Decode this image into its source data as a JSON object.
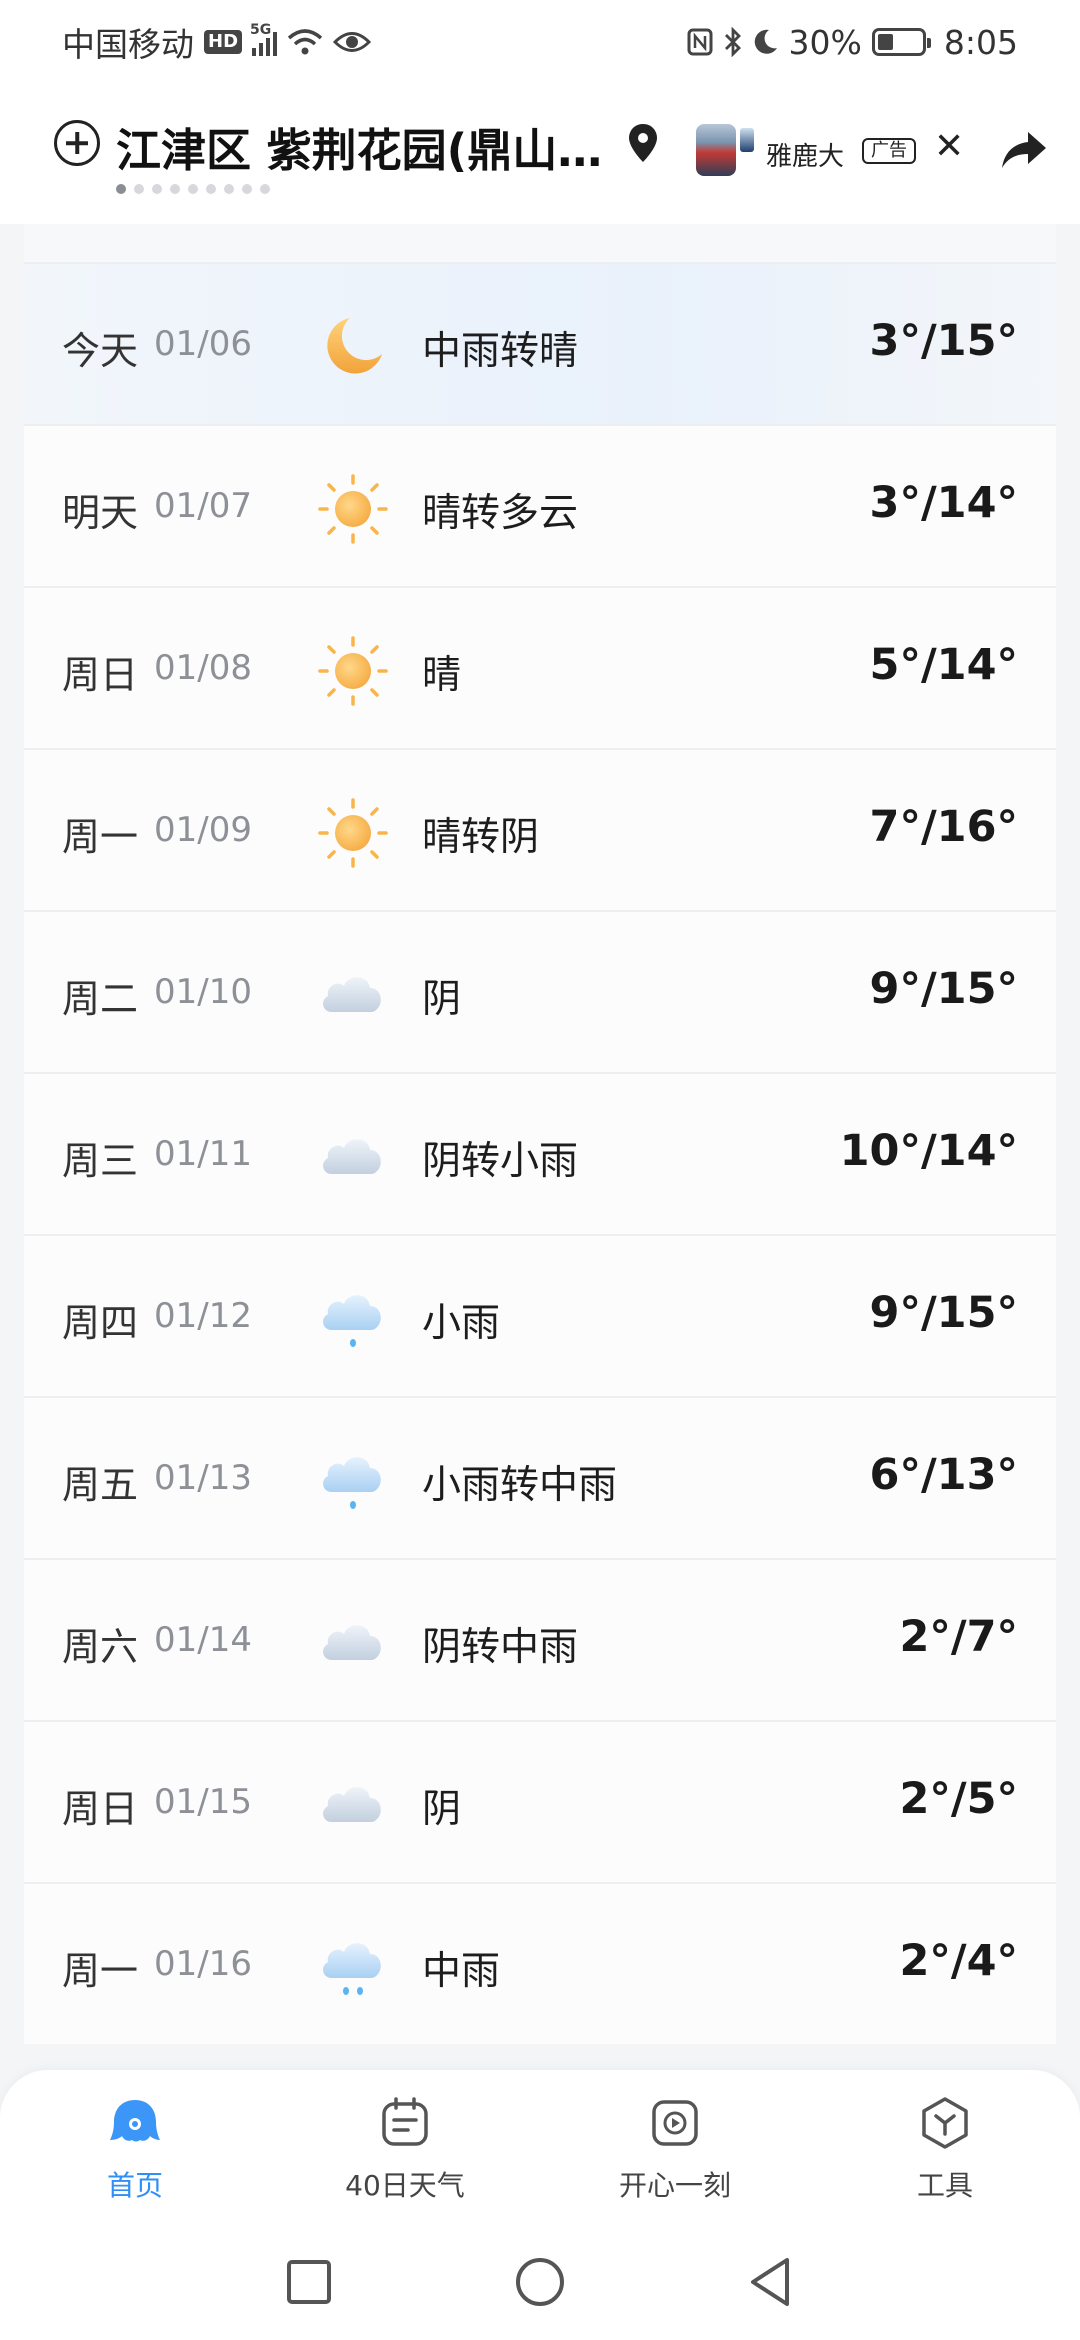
{
  "status_bar": {
    "carrier": "中国移动",
    "hd": "HD",
    "network": "5G",
    "battery": "30%",
    "time": "8:05"
  },
  "header": {
    "location": "江津区 紫荆花园(鼎山…",
    "ad_name": "雅鹿大",
    "ad_badge": "广告",
    "ad_close": "✕"
  },
  "forecast": [
    {
      "day": "今天",
      "date": "01/06",
      "icon": "moon-icon",
      "desc": "中雨转晴",
      "temp": "3°/15°"
    },
    {
      "day": "明天",
      "date": "01/07",
      "icon": "sun-icon",
      "desc": "晴转多云",
      "temp": "3°/14°"
    },
    {
      "day": "周日",
      "date": "01/08",
      "icon": "sun-icon",
      "desc": "晴",
      "temp": "5°/14°"
    },
    {
      "day": "周一",
      "date": "01/09",
      "icon": "sun-icon",
      "desc": "晴转阴",
      "temp": "7°/16°"
    },
    {
      "day": "周二",
      "date": "01/10",
      "icon": "cloud-icon",
      "desc": "阴",
      "temp": "9°/15°"
    },
    {
      "day": "周三",
      "date": "01/11",
      "icon": "cloud-icon",
      "desc": "阴转小雨",
      "temp": "10°/14°"
    },
    {
      "day": "周四",
      "date": "01/12",
      "icon": "light-rain-icon",
      "desc": "小雨",
      "temp": "9°/15°"
    },
    {
      "day": "周五",
      "date": "01/13",
      "icon": "light-rain-icon",
      "desc": "小雨转中雨",
      "temp": "6°/13°"
    },
    {
      "day": "周六",
      "date": "01/14",
      "icon": "cloud-icon",
      "desc": "阴转中雨",
      "temp": "2°/7°"
    },
    {
      "day": "周日",
      "date": "01/15",
      "icon": "cloud-icon",
      "desc": "阴",
      "temp": "2°/5°"
    },
    {
      "day": "周一",
      "date": "01/16",
      "icon": "moderate-rain-icon",
      "desc": "中雨",
      "temp": "2°/4°"
    }
  ],
  "bottom_nav": {
    "home": "首页",
    "forty_day": "40日天气",
    "happy_moment": "开心一刻",
    "tools": "工具"
  },
  "colors": {
    "accent": "#2f8ef7",
    "sun": "#f6b443",
    "cloud": "#c8d4e2",
    "rain": "#5ab4f0"
  }
}
